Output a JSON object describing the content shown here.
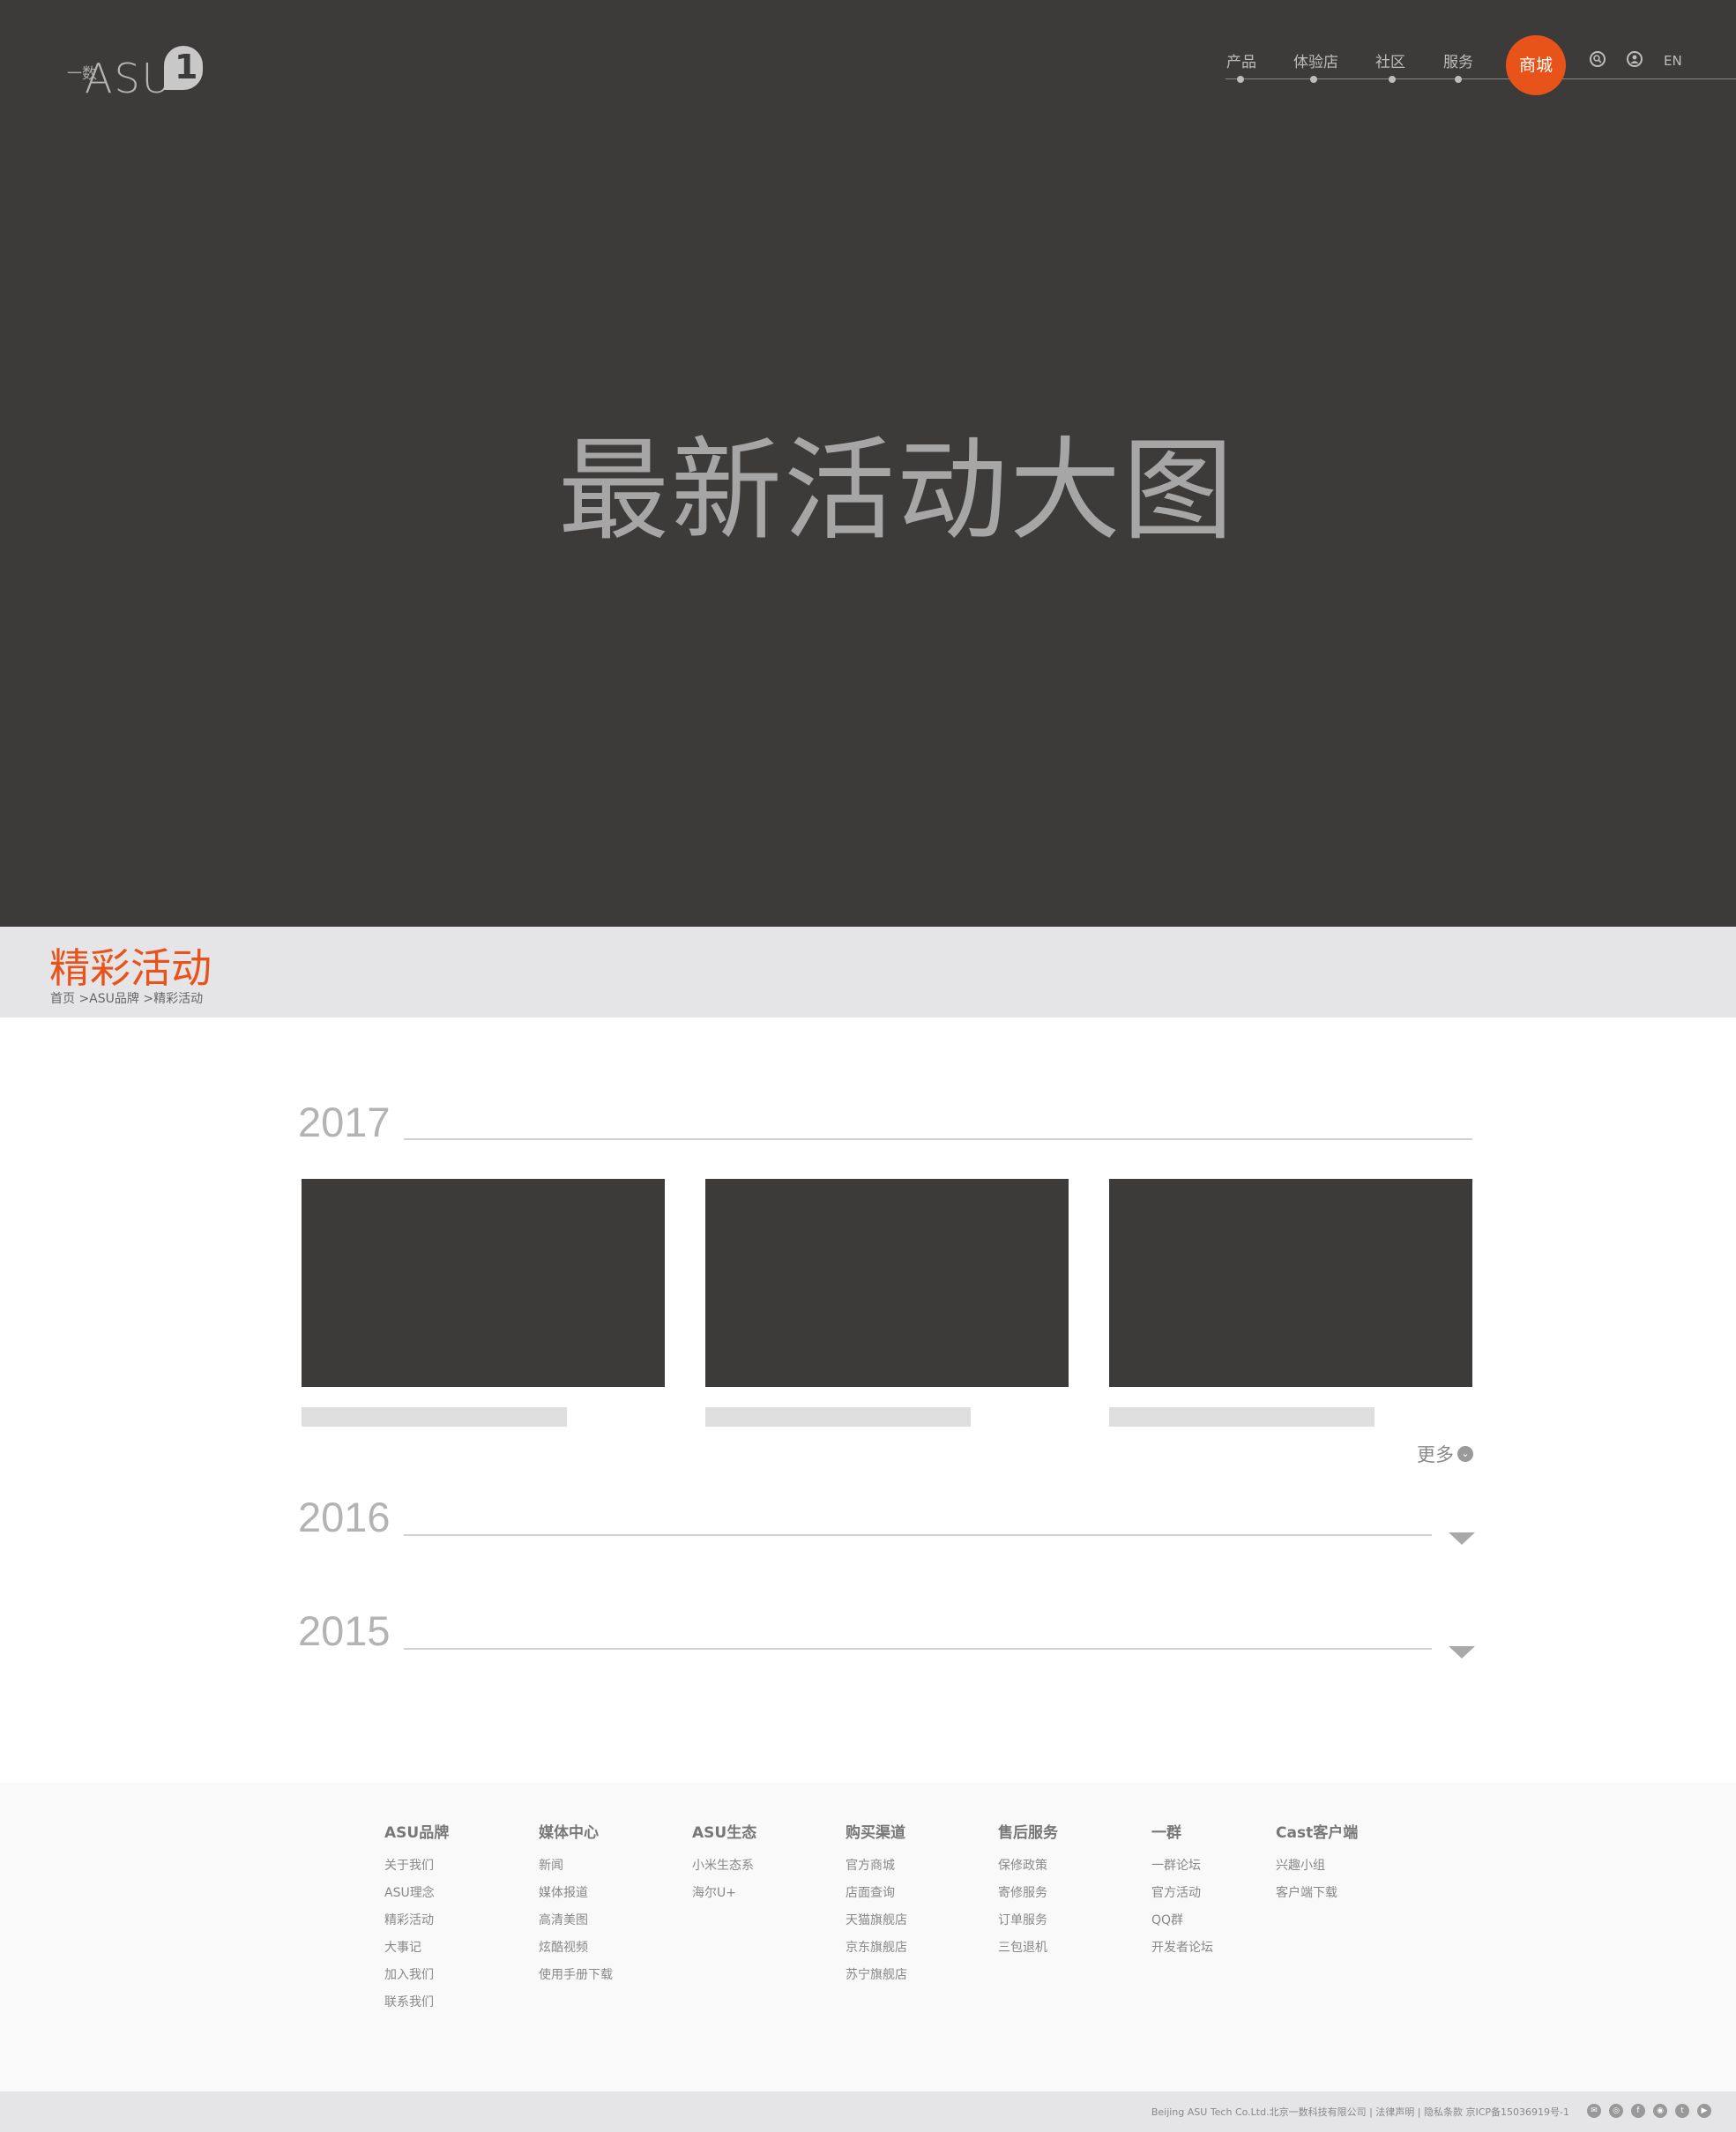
{
  "header": {
    "logo": {
      "tiny": "一数",
      "word": "ASU",
      "badge": "1"
    },
    "nav": [
      {
        "label": "产品"
      },
      {
        "label": "体验店"
      },
      {
        "label": "社区"
      },
      {
        "label": "服务"
      }
    ],
    "mall_label": "商城",
    "lang_label": "EN",
    "search_icon": "search-icon",
    "user_icon": "user-icon"
  },
  "hero": {
    "title": "最新活动大图"
  },
  "section": {
    "title": "精彩活动",
    "breadcrumb": "首页 >ASU品牌 >精彩活动"
  },
  "years": [
    {
      "year": "2017",
      "expanded": true
    },
    {
      "year": "2016",
      "expanded": false
    },
    {
      "year": "2015",
      "expanded": false
    }
  ],
  "more_label": "更多",
  "footer": {
    "columns": [
      {
        "heading": "ASU品牌",
        "items": [
          "关于我们",
          "ASU理念",
          "精彩活动",
          "大事记",
          "加入我们",
          "联系我们"
        ]
      },
      {
        "heading": "媒体中心",
        "items": [
          "新闻",
          "媒体报道",
          "高清美图",
          "炫酷视频",
          "使用手册下载"
        ]
      },
      {
        "heading": "ASU生态",
        "items": [
          "小米生态系",
          "海尔U+"
        ]
      },
      {
        "heading": "购买渠道",
        "items": [
          "官方商城",
          "店面查询",
          "天猫旗舰店",
          "京东旗舰店",
          "苏宁旗舰店"
        ]
      },
      {
        "heading": "售后服务",
        "items": [
          "保修政策",
          "寄修服务",
          "订单服务",
          "三包退机"
        ]
      },
      {
        "heading": "一群",
        "items": [
          "一群论坛",
          "官方活动",
          "QQ群",
          "开发者论坛"
        ]
      },
      {
        "heading": "Cast客户端",
        "items": [
          "兴趣小组",
          "客户端下载"
        ]
      }
    ],
    "copyright": "Beijing ASU Tech Co.Ltd.北京一数科技有限公司 | 法律声明 | 隐私条款  京ICP备15036919号-1",
    "social_icons": [
      "mail-icon",
      "weibo-icon",
      "facebook-icon",
      "instagram-icon",
      "twitter-icon",
      "youtube-icon"
    ]
  }
}
